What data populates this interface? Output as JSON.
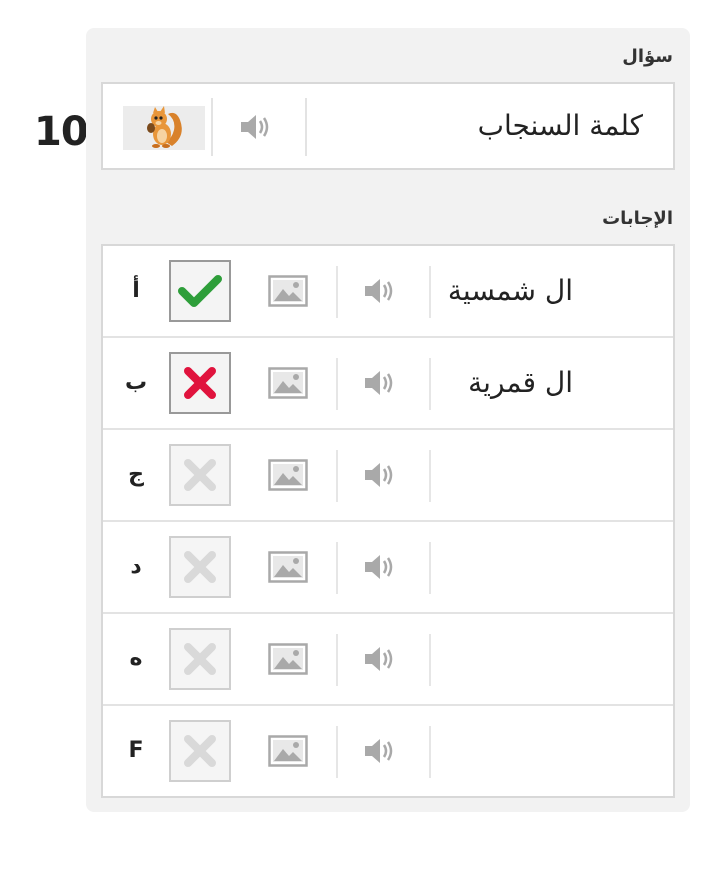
{
  "question": {
    "number": "10.",
    "section_label": "سؤال",
    "text": "كلمة السنجاب",
    "image_icon": "squirrel-image",
    "audio_icon": "speaker-icon"
  },
  "answers": {
    "section_label": "الإجابات",
    "items": [
      {
        "letter": "أ",
        "text": "ال شمسية",
        "mark": "check",
        "mark_color": "#2e9e3a"
      },
      {
        "letter": "ب",
        "text": "ال قمرية",
        "mark": "cross",
        "mark_color": "#e0133d"
      },
      {
        "letter": "ج",
        "text": "",
        "mark": "cross-inactive",
        "mark_color": "#d9d9d9"
      },
      {
        "letter": "د",
        "text": "",
        "mark": "cross-inactive",
        "mark_color": "#d9d9d9"
      },
      {
        "letter": "ه",
        "text": "",
        "mark": "cross-inactive",
        "mark_color": "#d9d9d9"
      },
      {
        "letter": "F",
        "text": "",
        "mark": "cross-inactive",
        "mark_color": "#d9d9d9"
      }
    ]
  },
  "colors": {
    "panel_bg": "#f2f2f2",
    "border": "#d8d8d8",
    "icon_gray": "#a9a9a9",
    "correct": "#2e9e3a",
    "wrong": "#e0133d"
  }
}
